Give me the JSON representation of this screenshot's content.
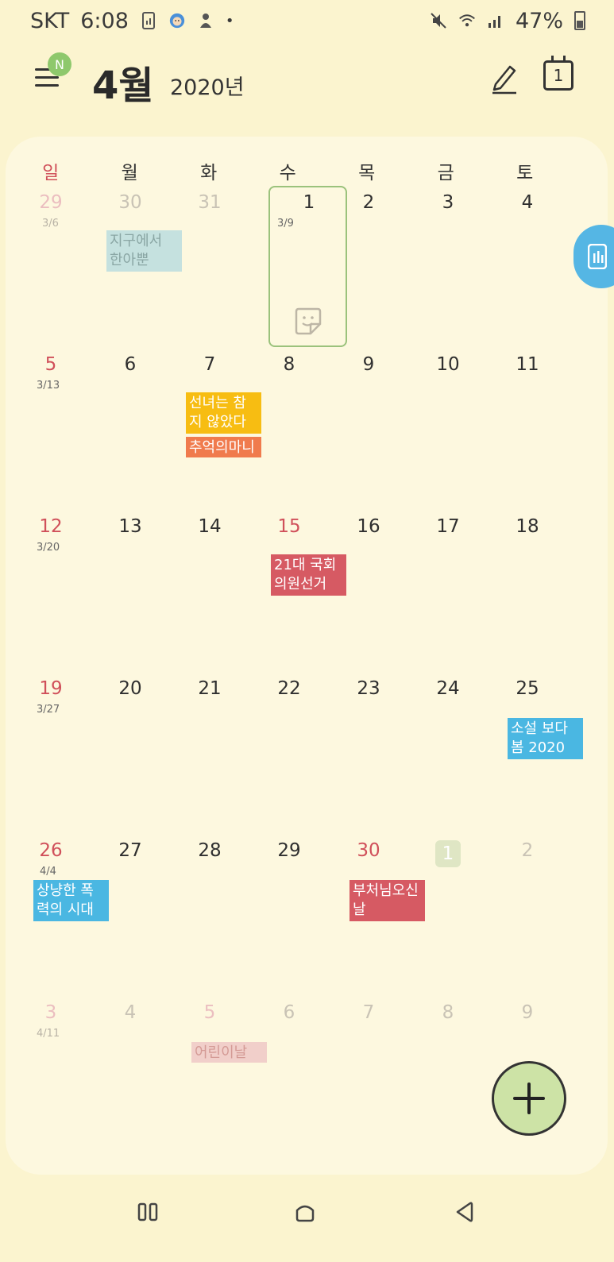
{
  "status_bar": {
    "carrier": "SKT",
    "time": "6:08",
    "battery": "47%"
  },
  "header": {
    "badge": "N",
    "month": "4월",
    "year": "2020년",
    "today_day": "1"
  },
  "weekdays": [
    "일",
    "월",
    "화",
    "수",
    "목",
    "금",
    "토"
  ],
  "weeks": [
    {
      "days": [
        {
          "num": "29",
          "lunar": "3/6"
        },
        {
          "num": "30"
        },
        {
          "num": "31"
        },
        {
          "num": "1",
          "lunar": "3/9"
        },
        {
          "num": "2"
        },
        {
          "num": "3"
        },
        {
          "num": "4"
        }
      ]
    },
    {
      "days": [
        {
          "num": "5",
          "lunar": "3/13"
        },
        {
          "num": "6"
        },
        {
          "num": "7"
        },
        {
          "num": "8"
        },
        {
          "num": "9"
        },
        {
          "num": "10"
        },
        {
          "num": "11"
        }
      ]
    },
    {
      "days": [
        {
          "num": "12",
          "lunar": "3/20"
        },
        {
          "num": "13"
        },
        {
          "num": "14"
        },
        {
          "num": "15"
        },
        {
          "num": "16"
        },
        {
          "num": "17"
        },
        {
          "num": "18"
        }
      ]
    },
    {
      "days": [
        {
          "num": "19",
          "lunar": "3/27"
        },
        {
          "num": "20"
        },
        {
          "num": "21"
        },
        {
          "num": "22"
        },
        {
          "num": "23"
        },
        {
          "num": "24"
        },
        {
          "num": "25"
        }
      ]
    },
    {
      "days": [
        {
          "num": "26",
          "lunar": "4/4"
        },
        {
          "num": "27"
        },
        {
          "num": "28"
        },
        {
          "num": "29"
        },
        {
          "num": "30"
        },
        {
          "num": "1"
        },
        {
          "num": "2"
        }
      ]
    },
    {
      "days": [
        {
          "num": "3",
          "lunar": "4/11"
        },
        {
          "num": "4"
        },
        {
          "num": "5"
        },
        {
          "num": "6"
        },
        {
          "num": "7"
        },
        {
          "num": "8"
        },
        {
          "num": "9"
        }
      ]
    }
  ],
  "events": {
    "e1": "지구에서 한아뿐",
    "e2": "선녀는 참지 않았다",
    "e3": "추억의마니",
    "e4": "21대 국회의원선거",
    "e5": "소설 보다 봄 2020",
    "e6": "상냥한 폭력의 시대",
    "e7": "부처님오신날",
    "e8": "어린이날"
  },
  "colors": {
    "background": "#fbf4cf",
    "card": "#fdf8df",
    "sunday_red": "#d0505a",
    "today_border": "#9bc27c",
    "fab": "#cde3a6"
  }
}
